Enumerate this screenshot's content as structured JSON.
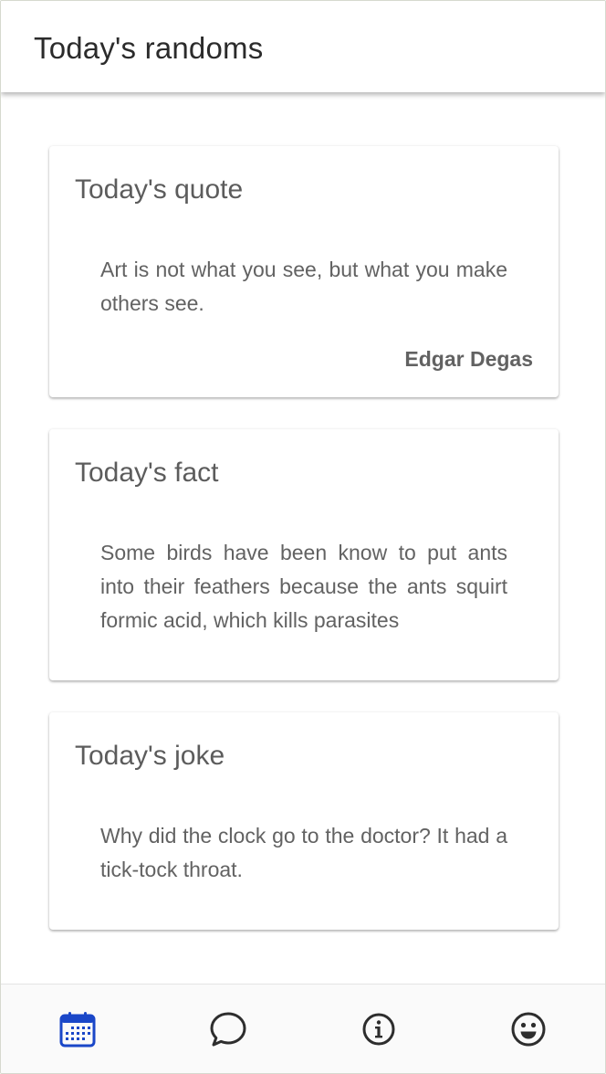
{
  "header": {
    "title": "Today's randoms"
  },
  "cards": {
    "quote": {
      "title": "Today's quote",
      "text": "Art is not what you see, but what you make others see.",
      "author": "Edgar Degas"
    },
    "fact": {
      "title": "Today's fact",
      "text": "Some birds have been know to put ants into their feathers because the ants squirt formic acid, which kills parasites"
    },
    "joke": {
      "title": "Today's joke",
      "text": "Why did the clock go to the doctor? It had a tick-tock throat."
    }
  },
  "bottom_nav": {
    "items": [
      {
        "icon": "calendar-icon",
        "active": true
      },
      {
        "icon": "chat-bubble-icon",
        "active": false
      },
      {
        "icon": "info-icon",
        "active": false
      },
      {
        "icon": "smiley-icon",
        "active": false
      }
    ]
  },
  "colors": {
    "accent": "#1a47c8",
    "icon": "#2d2d2d",
    "text": "#626262",
    "title": "#2b2b2b"
  }
}
